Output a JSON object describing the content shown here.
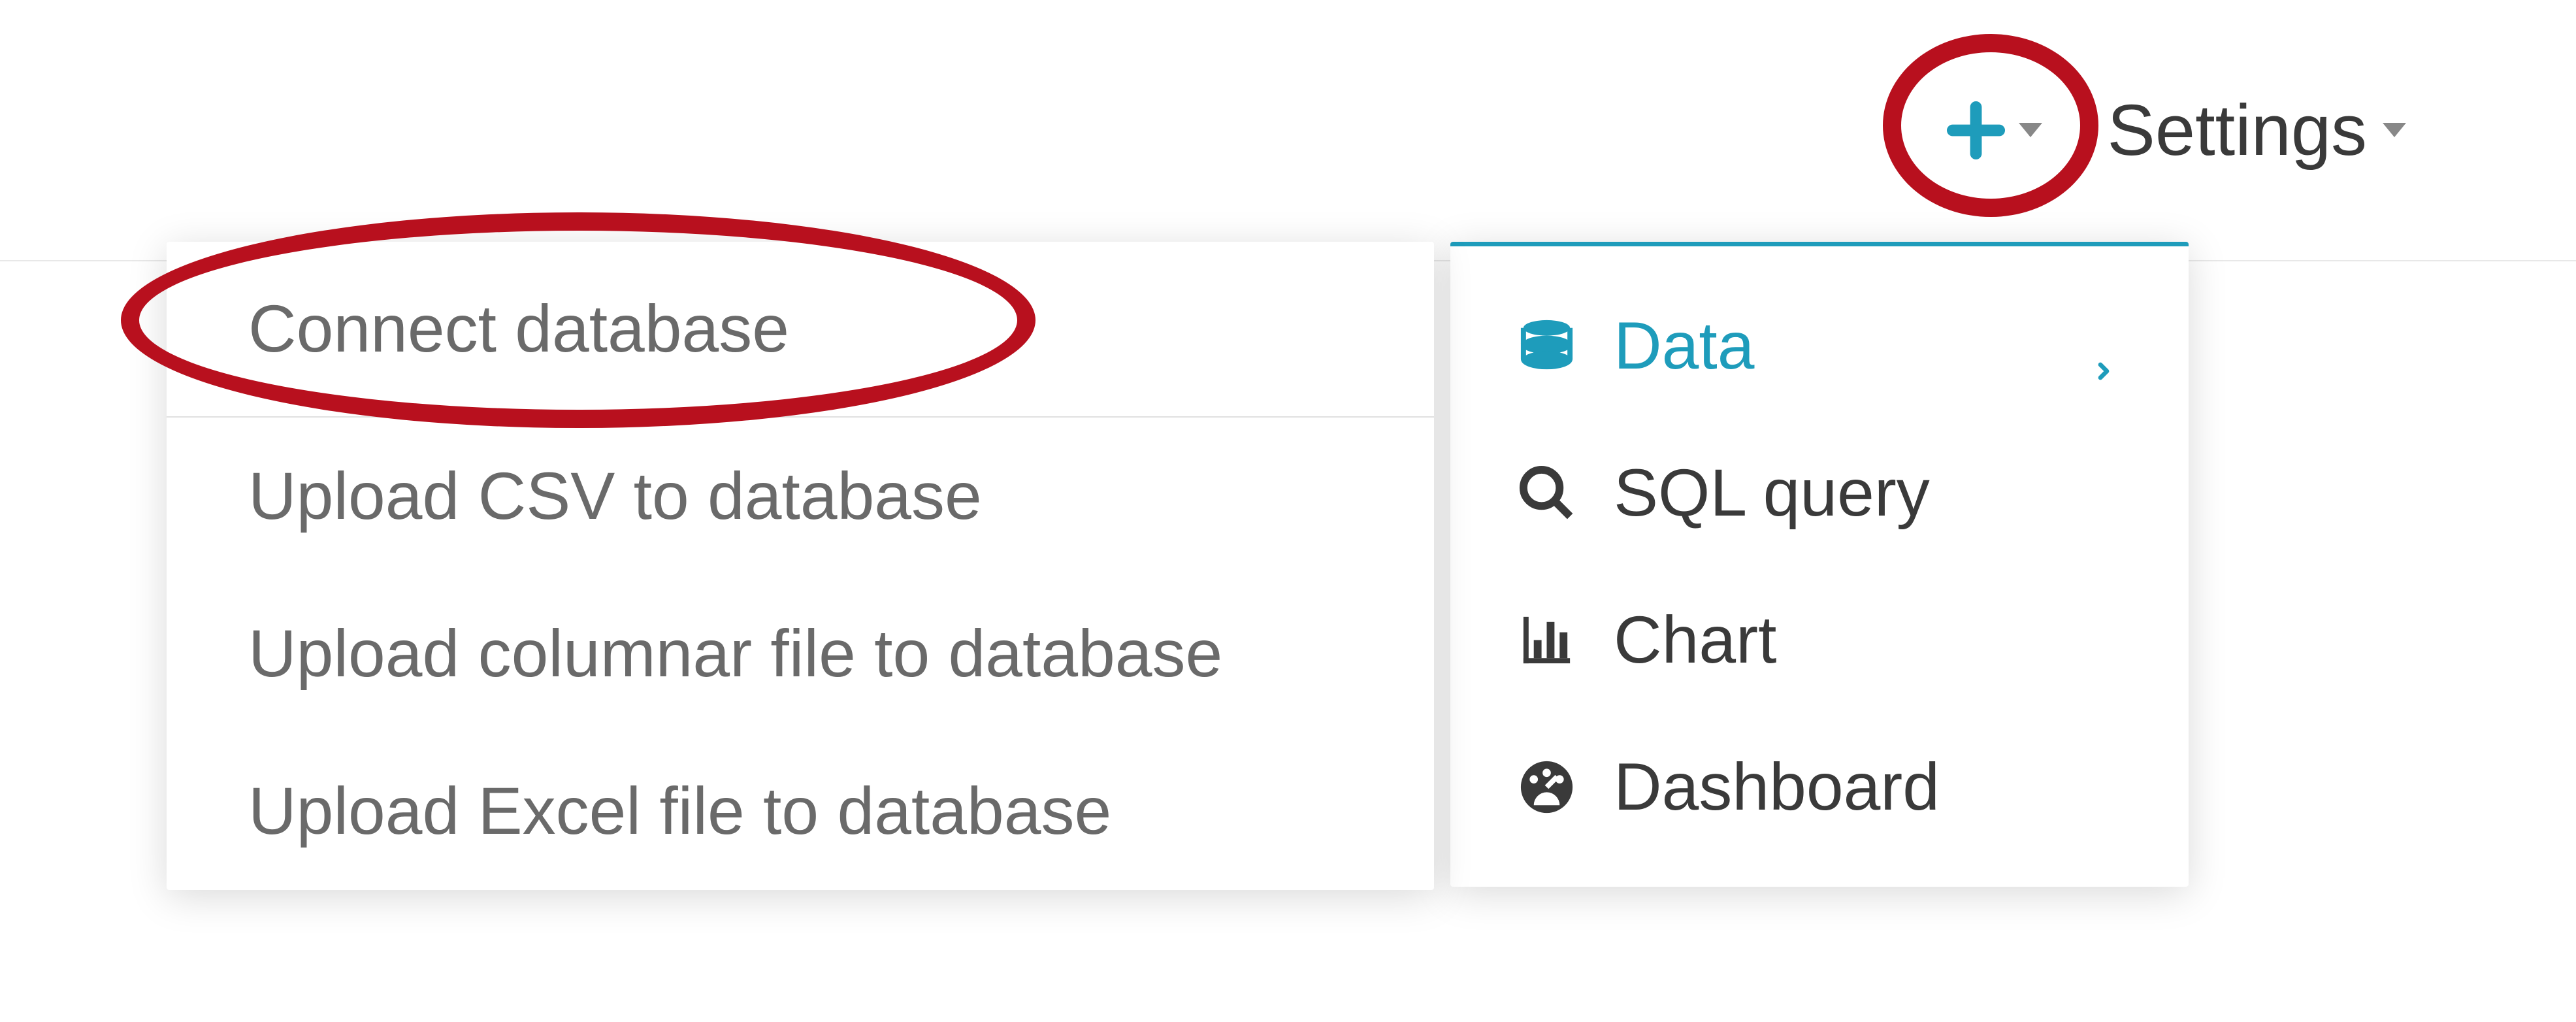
{
  "header": {
    "settings_label": "Settings"
  },
  "primary_menu": {
    "items": [
      {
        "label": "Data"
      },
      {
        "label": "SQL query"
      },
      {
        "label": "Chart"
      },
      {
        "label": "Dashboard"
      }
    ]
  },
  "data_submenu": {
    "items": [
      {
        "label": "Connect database"
      },
      {
        "label": "Upload CSV to database"
      },
      {
        "label": "Upload columnar file to database"
      },
      {
        "label": "Upload Excel file to database"
      }
    ]
  }
}
